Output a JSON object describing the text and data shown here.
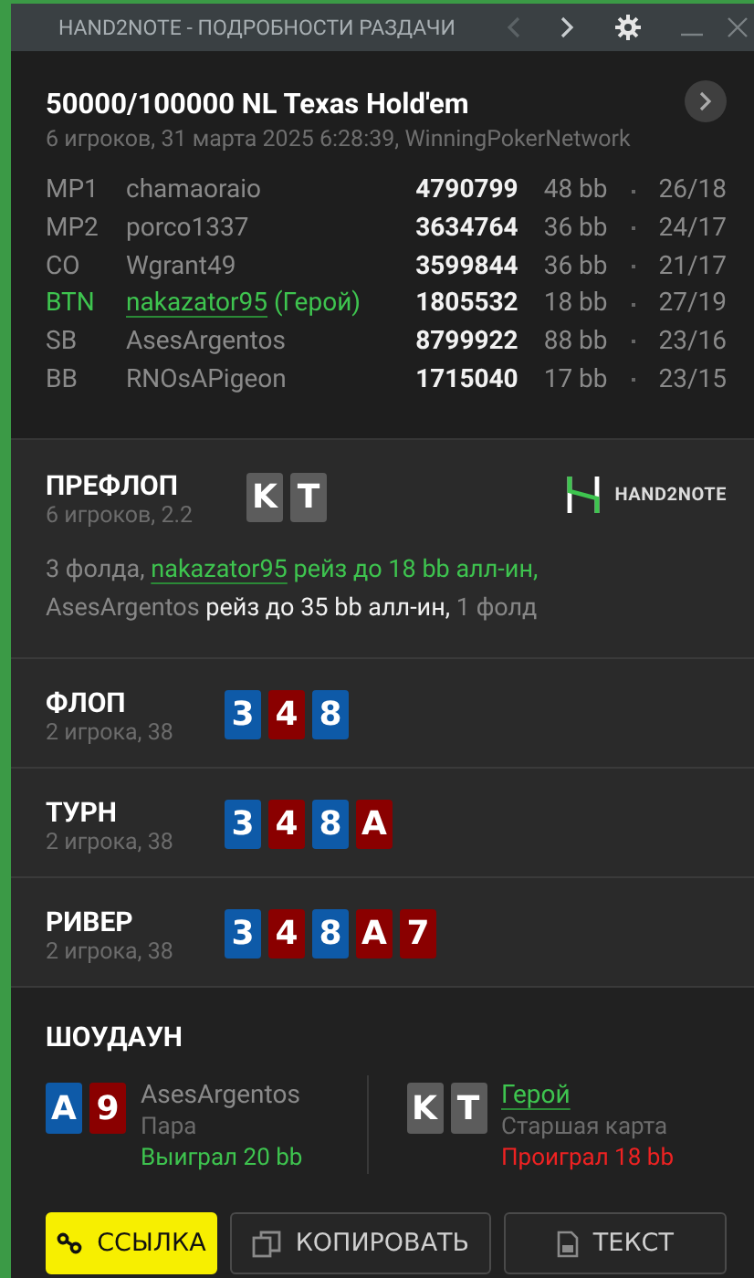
{
  "window": {
    "title": "HAND2NOTE - ПОДРОБНОСТИ РАЗДАЧИ",
    "back_disabled": true
  },
  "hand": {
    "title": "50000/100000 NL Texas Hold'em",
    "subtitle": "6 игроков, 31 марта 2025 6:28:39, WinningPokerNetwork",
    "players": [
      {
        "position": "MP1",
        "name": "chamaoraio",
        "hero": false,
        "stack": "4790799",
        "bb": "48 bb",
        "stats": "26/18"
      },
      {
        "position": "MP2",
        "name": "porco1337",
        "hero": false,
        "stack": "3634764",
        "bb": "36 bb",
        "stats": "24/17"
      },
      {
        "position": "CO",
        "name": "Wgrant49",
        "hero": false,
        "stack": "3599844",
        "bb": "36 bb",
        "stats": "21/17"
      },
      {
        "position": "BTN",
        "name": "nakazator95",
        "tag": "(Герой)",
        "hero": true,
        "stack": "1805532",
        "bb": "18 bb",
        "stats": "27/19"
      },
      {
        "position": "SB",
        "name": "AsesArgentos",
        "hero": false,
        "stack": "8799922",
        "bb": "88 bb",
        "stats": "23/16"
      },
      {
        "position": "BB",
        "name": "RNOsAPigeon",
        "hero": false,
        "stack": "1715040",
        "bb": "17 bb",
        "stats": "23/15"
      }
    ]
  },
  "streets": [
    {
      "title": "ПРЕФЛОП",
      "subtitle": "6 игроков, 2.2",
      "logo": "HAND2NOTE",
      "cards": [
        {
          "rank": "K",
          "color": "#5c5c5c"
        },
        {
          "rank": "T",
          "color": "#5c5c5c"
        }
      ],
      "actions": [
        {
          "kind": "plain",
          "text": "3 фолда, "
        },
        {
          "kind": "hero-name",
          "text": "nakazator95"
        },
        {
          "kind": "hero-action",
          "text": " рейз до 18 bb алл-ин, "
        },
        {
          "kind": "plain",
          "text": "AsesArgentos"
        },
        {
          "kind": "action",
          "text": " рейз до 35 bb алл-ин,"
        },
        {
          "kind": "plain",
          "text": " 1 фолд"
        }
      ]
    },
    {
      "title": "ФЛОП",
      "subtitle": "2 игрока, 38",
      "cards": [
        {
          "rank": "3",
          "color": "#0e5aa8"
        },
        {
          "rank": "4",
          "color": "#8a0000"
        },
        {
          "rank": "8",
          "color": "#0e5aa8"
        }
      ]
    },
    {
      "title": "ТУРН",
      "subtitle": "2 игрока, 38",
      "cards": [
        {
          "rank": "3",
          "color": "#0e5aa8"
        },
        {
          "rank": "4",
          "color": "#8a0000"
        },
        {
          "rank": "8",
          "color": "#0e5aa8"
        },
        {
          "rank": "A",
          "color": "#8a0000"
        }
      ]
    },
    {
      "title": "РИВЕР",
      "subtitle": "2 игрока, 38",
      "cards": [
        {
          "rank": "3",
          "color": "#0e5aa8"
        },
        {
          "rank": "4",
          "color": "#8a0000"
        },
        {
          "rank": "8",
          "color": "#0e5aa8"
        },
        {
          "rank": "A",
          "color": "#8a0000"
        },
        {
          "rank": "7",
          "color": "#8a0000"
        }
      ]
    }
  ],
  "showdown": {
    "title": "ШОУДАУН",
    "hands": [
      {
        "name": "AsesArgentos",
        "hero": false,
        "hand": "Пара",
        "result": "Выиграл 20 bb",
        "won": true,
        "cards": [
          {
            "rank": "A",
            "color": "#0e5aa8"
          },
          {
            "rank": "9",
            "color": "#8a0000"
          }
        ]
      },
      {
        "name": "Герой",
        "hero": true,
        "hand": "Старшая карта",
        "result": "Проиграл 18 bb",
        "won": false,
        "cards": [
          {
            "rank": "K",
            "color": "#5c5c5c"
          },
          {
            "rank": "T",
            "color": "#5c5c5c"
          }
        ]
      }
    ]
  },
  "buttons": [
    {
      "label": "ССЫЛКА",
      "kind": "link",
      "primary": true
    },
    {
      "label": "КОПИРОВАТЬ",
      "kind": "copy",
      "primary": false
    },
    {
      "label": "ТЕКСТ",
      "kind": "text",
      "primary": false
    }
  ]
}
